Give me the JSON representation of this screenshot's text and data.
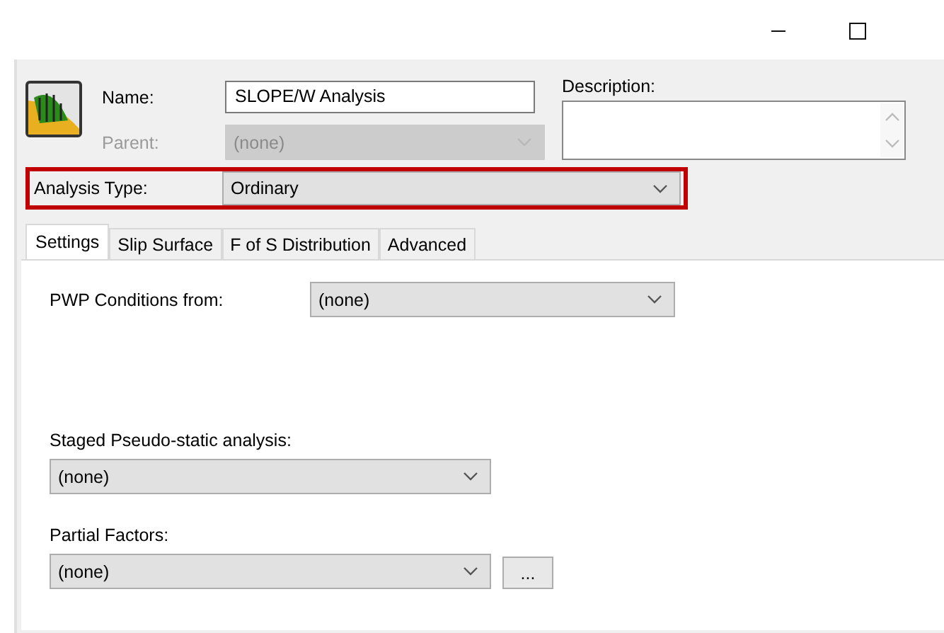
{
  "window": {
    "controls": [
      {
        "kind": "minimize"
      },
      {
        "kind": "maximize"
      }
    ]
  },
  "name": {
    "label": "Name:",
    "value": "SLOPE/W Analysis"
  },
  "parent": {
    "label": "Parent:",
    "value": "(none)",
    "disabled": true
  },
  "description": {
    "label": "Description:"
  },
  "analysis_type": {
    "label": "Analysis Type:",
    "value": "Ordinary",
    "highlighted": true
  },
  "tabs": [
    {
      "label": "Settings",
      "selected": true
    },
    {
      "label": "Slip Surface",
      "selected": false
    },
    {
      "label": "F of S Distribution",
      "selected": false
    },
    {
      "label": "Advanced",
      "selected": false
    }
  ],
  "settings": {
    "pwp": {
      "label": "PWP Conditions from:",
      "value": "(none)"
    },
    "staged": {
      "label": "Staged Pseudo-static analysis:",
      "value": "(none)"
    },
    "partial_factors": {
      "label": "Partial Factors:",
      "value": "(none)",
      "button": "..."
    }
  }
}
